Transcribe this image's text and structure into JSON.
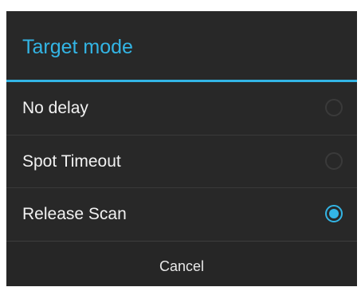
{
  "dialog": {
    "title": "Target mode",
    "options": [
      {
        "label": "No delay",
        "selected": false
      },
      {
        "label": "Spot Timeout",
        "selected": false
      },
      {
        "label": "Release Scan",
        "selected": true
      }
    ],
    "cancel_label": "Cancel"
  },
  "colors": {
    "accent": "#33b5e5",
    "background": "#282828",
    "text": "#f2f2f2"
  }
}
